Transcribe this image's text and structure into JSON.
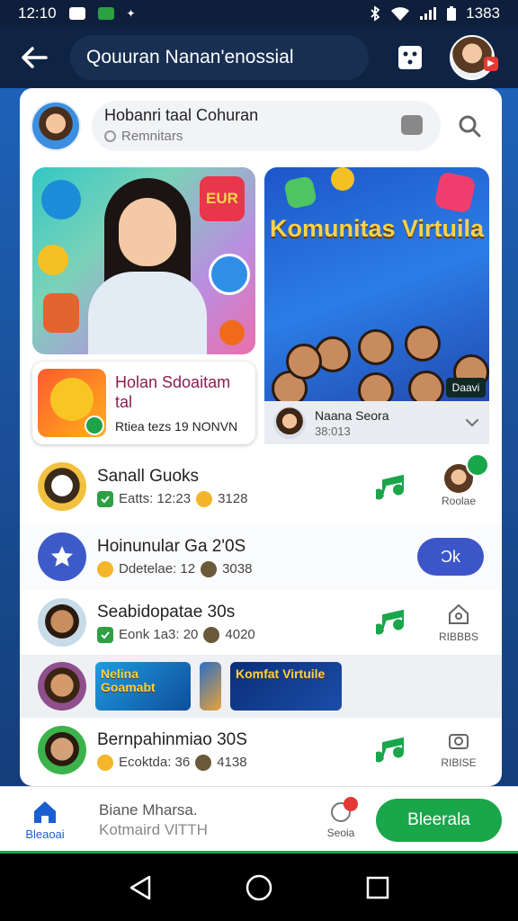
{
  "status_bar": {
    "time": "12:10",
    "right_text": "1383"
  },
  "app_bar": {
    "title": "Qouuran Nanan'enossial"
  },
  "header": {
    "name": "Hobanri taal Cohuran",
    "subtitle": "Remnitars"
  },
  "promo_left": {
    "card_title": "Holan Sdoaitam tal",
    "card_sub": "Rtiea tezs 19 NONVN",
    "badge_text": "EUR"
  },
  "promo_right": {
    "title": "Komunitas Virtuila",
    "badge": "Daavi",
    "name": "Naana Seora",
    "time": "38:013"
  },
  "list": [
    {
      "title": "Sanall Guoks",
      "meta_a": "Eatts: 12:23",
      "meta_b": "3128",
      "side_label": "Roolae"
    },
    {
      "title": "Hoinunular Ga 2'0S",
      "meta_a": "Ddetelae: 12",
      "meta_b": "3038",
      "button": "Ɔk"
    },
    {
      "title": "Seabidopatae 30s",
      "meta_a": "Eonk 1a3: 20",
      "meta_b": "4020",
      "side_label": "RIBBBS"
    },
    {
      "title": "Bernpahinmiao 30S",
      "meta_a": "Ecoktda: 36",
      "meta_b": "4138",
      "side_label": "RIBISE"
    }
  ],
  "strip": {
    "thumb1": "Nelina Goamabt",
    "thumb2": "Komfat Virtuile"
  },
  "bottom_bar": {
    "home_label": "Bleaoai",
    "text1": "Biane Mharsa.",
    "text2": "Kotmaird VlTTH",
    "notif_label": "Seoia",
    "cta": "Bleerala"
  },
  "colors": {
    "accent_green": "#1aa64b",
    "accent_blue": "#3c56c9",
    "app_bar": "#0f2444"
  }
}
